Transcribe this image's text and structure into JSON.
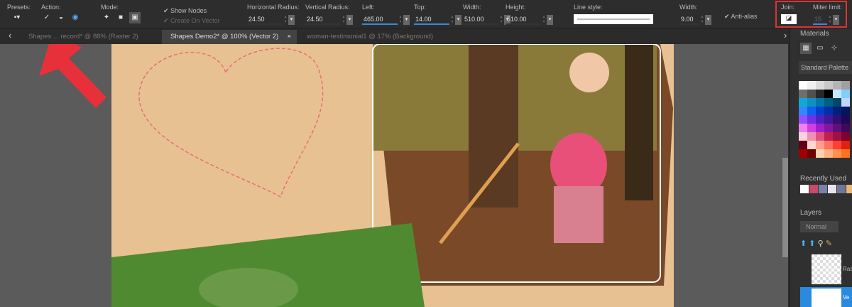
{
  "toolbar": {
    "presets_label": "Presets:",
    "action_label": "Action:",
    "mode_label": "Mode:",
    "show_nodes": "Show Nodes",
    "create_on_vector": "Create On Vector",
    "hradius_label": "Horizontal Radius:",
    "hradius": "24.50",
    "vradius_label": "Vertical Radius:",
    "vradius": "24.50",
    "left_label": "Left:",
    "left": "465.00",
    "top_label": "Top:",
    "top": "14.00",
    "width_label": "Width:",
    "width": "510.00",
    "height_label": "Height:",
    "height": "510.00",
    "line_style_label": "Line style:",
    "stroke_width_label": "Width:",
    "stroke_width": "9.00",
    "antialias": "Anti-alias",
    "join_label": "Join:",
    "miter_label": "Miter limit:",
    "miter": "15"
  },
  "tabs": [
    {
      "label": "Shapes ... record* @ 88% (Raster 2)"
    },
    {
      "label": "Shapes Demo2* @ 100% (Vector 2)",
      "close": "×"
    },
    {
      "label": "woman-testimonial1 @ 17% (Background)"
    }
  ],
  "nav": {
    "prev": "‹",
    "next": "›"
  },
  "panel": {
    "materials": "Materials",
    "palette": "Standard Palette",
    "recently_used": "Recently Used",
    "layers": "Layers",
    "blend_mode": "Normal",
    "layer1": "Ras",
    "layer2": "Ve",
    "palette_colors": [
      "#ffffff",
      "#f0f0f0",
      "#dcdcdc",
      "#c8c8c8",
      "#b4b4b4",
      "#a0a0a0",
      "#6e6e6e",
      "#505050",
      "#282828",
      "#000000",
      "#c8e8ff",
      "#80d0ff",
      "#10a8d8",
      "#1090c0",
      "#0078a8",
      "#006080",
      "#004868",
      "#c0d8ff",
      "#3088ff",
      "#1060f0",
      "#0040d0",
      "#0030a8",
      "#002080",
      "#001858",
      "#9050ff",
      "#7030e8",
      "#5020c0",
      "#401898",
      "#301070",
      "#200858",
      "#f080f0",
      "#d040e0",
      "#a020c8",
      "#8018a0",
      "#601078",
      "#400858",
      "#ffd0e0",
      "#f090b0",
      "#e05080",
      "#c02050",
      "#a01040",
      "#800030",
      "#600018",
      "#ffd8d0",
      "#ffa090",
      "#ff7060",
      "#ff4030",
      "#e02010",
      "#a00000",
      "#700000",
      "#ffd0b0",
      "#ffb080",
      "#ff9050",
      "#ff7020"
    ],
    "recent_colors": [
      "#ffffff",
      "#c84a6e",
      "#7a80a8",
      "#e8e4ee",
      "#707898",
      "#e8b878"
    ]
  }
}
